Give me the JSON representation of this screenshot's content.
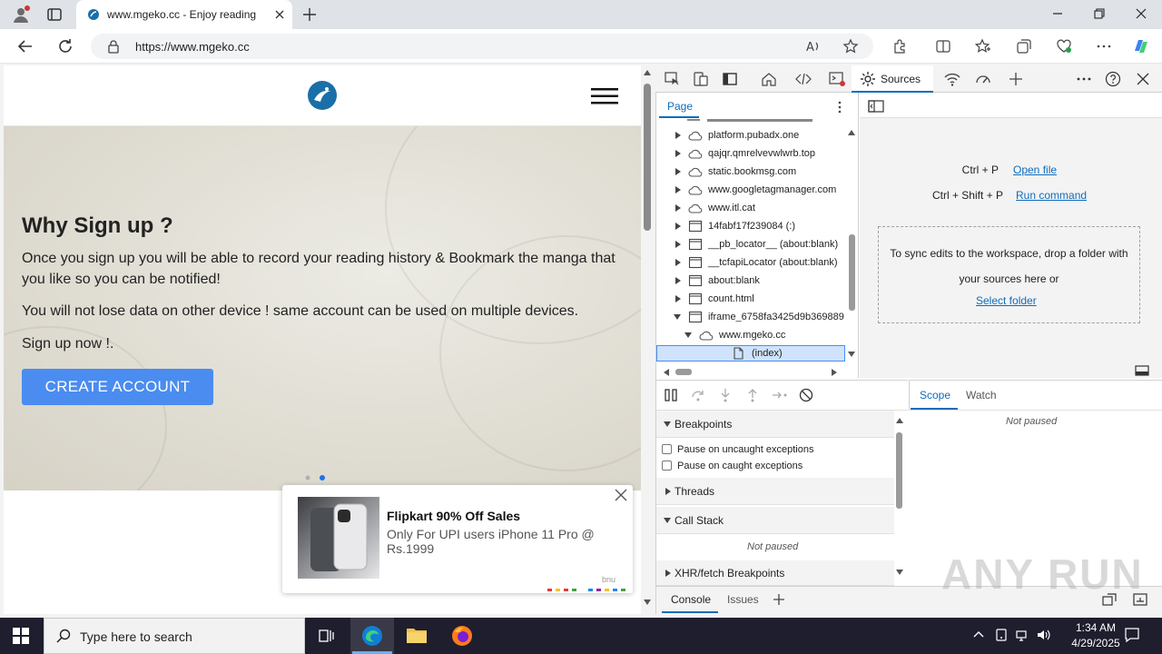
{
  "browser": {
    "tab_title": "www.mgeko.cc - Enjoy reading",
    "url": "https://www.mgeko.cc"
  },
  "site": {
    "hero_title": "Why Sign up ?",
    "hero_p1": "Once you sign up you will be able to record your reading history & Bookmark the manga that you like so you can be notified!",
    "hero_p2": "You will not lose data on other device ! same account can be used on multiple devices.",
    "hero_p3": "Sign up now !.",
    "create_button": "CREATE ACCOUNT",
    "ad": {
      "title": "Flipkart 90% Off Sales",
      "description": "Only For UPI users iPhone 11 Pro @ Rs.1999",
      "brand": "bnu"
    }
  },
  "devtools": {
    "active_tab": "Sources",
    "navigator_tab": "Page",
    "tree": [
      {
        "label": "platform.pubadx.one",
        "type": "cloud",
        "depth": 0,
        "expanded": false
      },
      {
        "label": "qajqr.qmrelvevwlwrb.top",
        "type": "cloud",
        "depth": 0,
        "expanded": false
      },
      {
        "label": "static.bookmsg.com",
        "type": "cloud",
        "depth": 0,
        "expanded": false
      },
      {
        "label": "www.googletagmanager.com",
        "type": "cloud",
        "depth": 0,
        "expanded": false
      },
      {
        "label": "www.itl.cat",
        "type": "cloud",
        "depth": 0,
        "expanded": false
      },
      {
        "label": "14fabf17f239084 (:)",
        "type": "frame",
        "depth": 0,
        "expanded": false
      },
      {
        "label": "__pb_locator__ (about:blank)",
        "type": "frame",
        "depth": 0,
        "expanded": false
      },
      {
        "label": "__tcfapiLocator (about:blank)",
        "type": "frame",
        "depth": 0,
        "expanded": false
      },
      {
        "label": "about:blank",
        "type": "frame",
        "depth": 0,
        "expanded": false
      },
      {
        "label": "count.html",
        "type": "frame",
        "depth": 0,
        "expanded": false
      },
      {
        "label": "iframe_6758fa3425d9b369889",
        "type": "frame",
        "depth": 0,
        "expanded": true
      },
      {
        "label": "www.mgeko.cc",
        "type": "cloud",
        "depth": 1,
        "expanded": true
      },
      {
        "label": "(index)",
        "type": "file",
        "depth": 2,
        "expanded": false
      }
    ],
    "editor": {
      "shortcut1_keys": "Ctrl + P",
      "shortcut1_link": "Open file",
      "shortcut2_keys": "Ctrl + Shift + P",
      "shortcut2_link": "Run command",
      "dropzone_text": "To sync edits to the workspace, drop a folder with your sources here or",
      "dropzone_link": "Select folder"
    },
    "debugger": {
      "breakpoints": "Breakpoints",
      "pause_uncaught": "Pause on uncaught exceptions",
      "pause_caught": "Pause on caught exceptions",
      "threads": "Threads",
      "call_stack": "Call Stack",
      "not_paused": "Not paused",
      "xhr": "XHR/fetch Breakpoints"
    },
    "scope": {
      "scope_tab": "Scope",
      "watch_tab": "Watch",
      "not_paused": "Not paused"
    },
    "drawer": {
      "console_tab": "Console",
      "issues_tab": "Issues"
    }
  },
  "watermark": "ANY RUN",
  "taskbar": {
    "search_placeholder": "Type here to search",
    "time": "1:34 AM",
    "date": "4/29/2025"
  },
  "colors": {
    "accent": "#0f6cbd",
    "create_button": "#4a8cf0",
    "taskbar": "#1e1e2e"
  }
}
